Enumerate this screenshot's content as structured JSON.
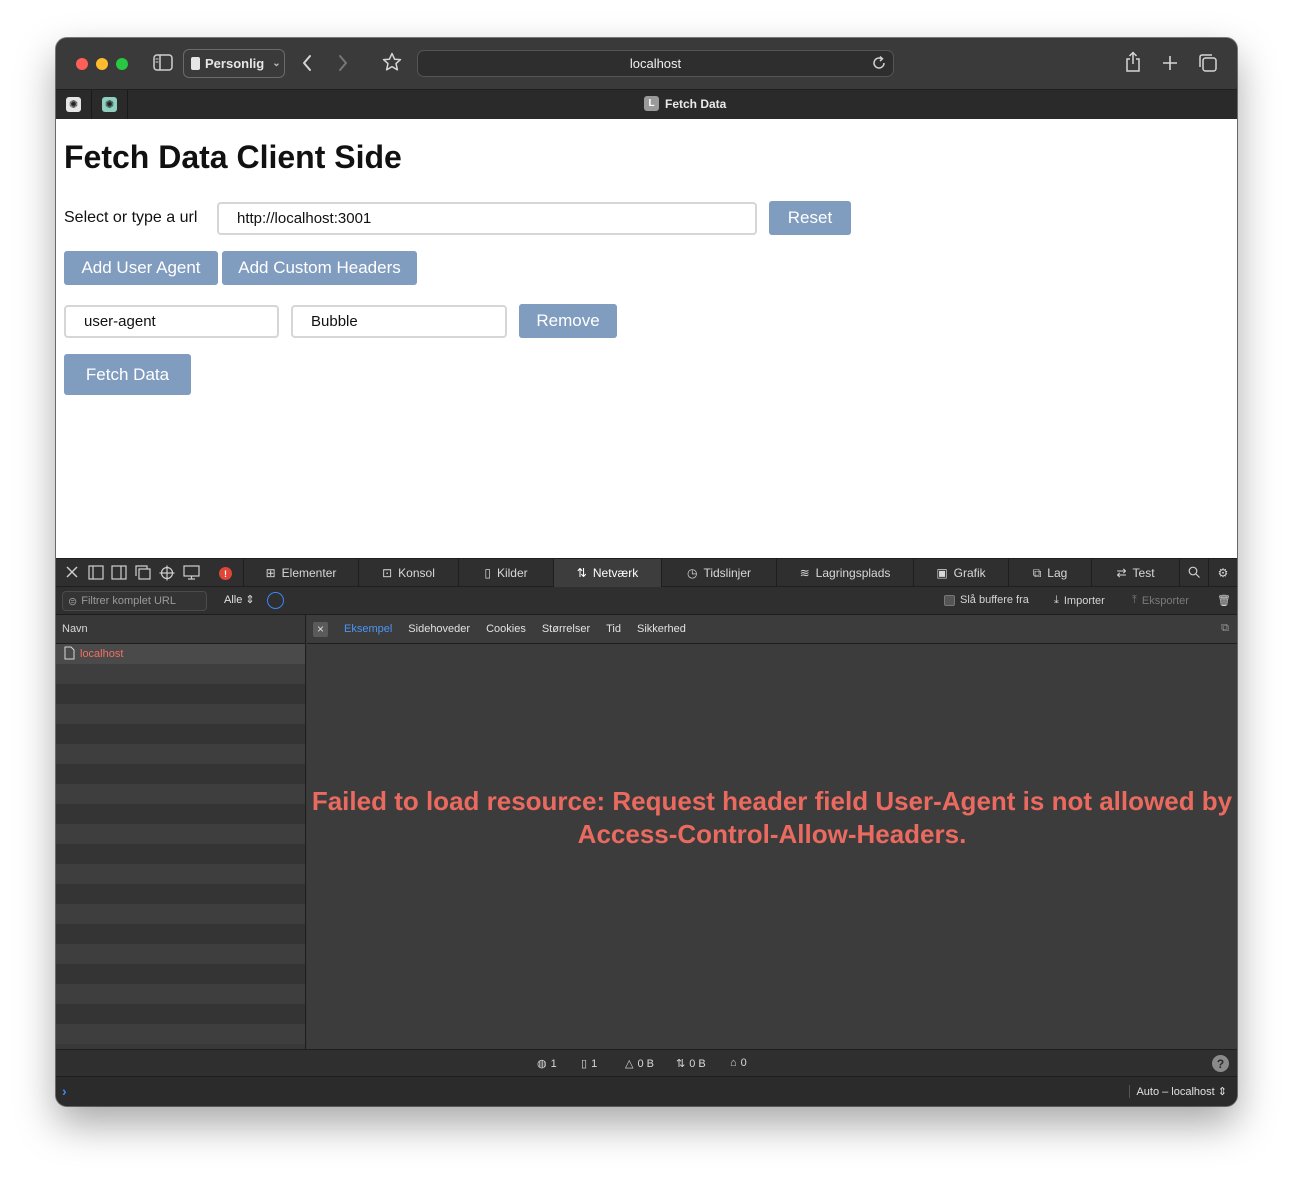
{
  "browser": {
    "profile_label": "Personlig",
    "url": "localhost",
    "tab_title": "Fetch Data",
    "tab_favicon_letter": "L"
  },
  "page": {
    "title": "Fetch Data Client Side",
    "url_label": "Select or type a url",
    "url_value": "http://localhost:3001",
    "reset_label": "Reset",
    "add_user_agent_label": "Add User Agent",
    "add_custom_headers_label": "Add Custom Headers",
    "header_name_value": "user-agent",
    "header_value_value": "Bubble",
    "remove_label": "Remove",
    "fetch_label": "Fetch Data"
  },
  "devtools": {
    "tabs": [
      "Elementer",
      "Konsol",
      "Kilder",
      "Netværk",
      "Tidslinjer",
      "Lagringsplads",
      "Grafik",
      "Lag",
      "Test"
    ],
    "active_tab": "Netværk",
    "filter_placeholder": "Filtrer komplet URL",
    "filter_type": "Alle",
    "disable_cache_label": "Slå buffere fra",
    "import_label": "Importer",
    "export_label": "Eksporter",
    "list_header": "Navn",
    "requests": [
      "localhost"
    ],
    "detail_tabs": [
      "Eksempel",
      "Sidehoveder",
      "Cookies",
      "Størrelser",
      "Tid",
      "Sikkerhed"
    ],
    "active_detail_tab": "Eksempel",
    "error_message": "Failed to load resource: Request header field User-Agent is not allowed by Access-Control-Allow-Headers.",
    "status": {
      "requests": "1",
      "resources": "1",
      "transferred": "0 B",
      "size": "0 B",
      "errors": "0"
    },
    "console_context": "Auto – localhost"
  },
  "colors": {
    "button_bg": "#809cbf",
    "error_text": "#ea6a5f",
    "accent_blue": "#3f84f7"
  }
}
